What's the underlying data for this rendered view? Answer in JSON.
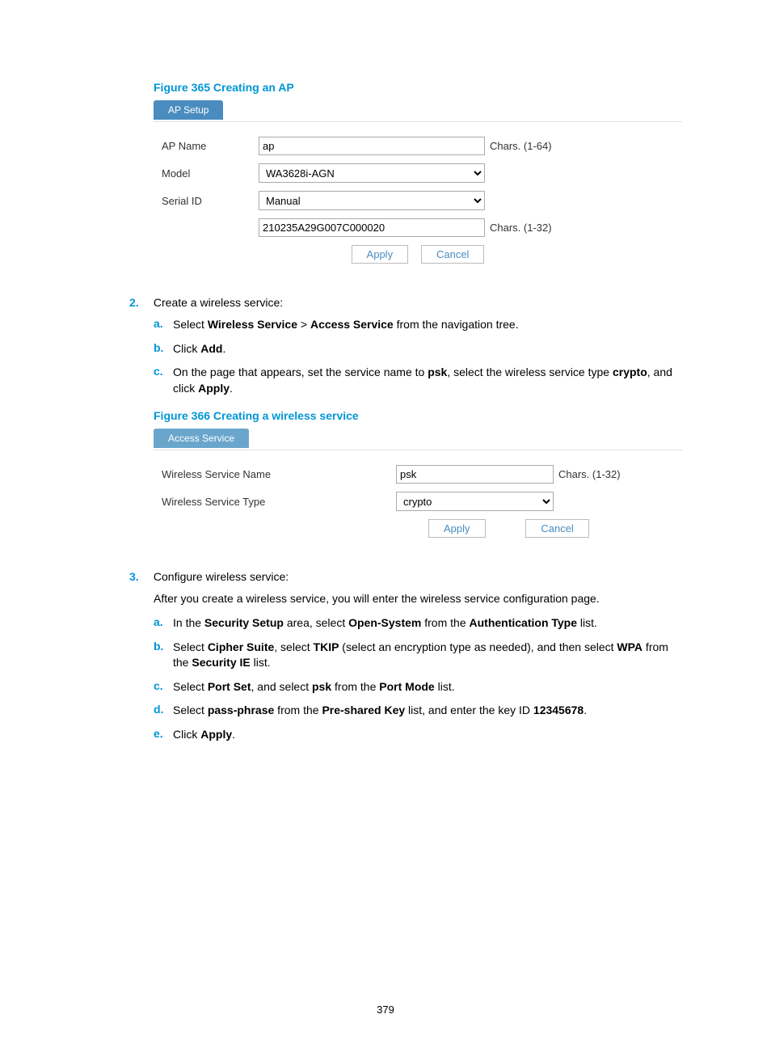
{
  "fig365": {
    "caption": "Figure 365 Creating an AP",
    "tab": "AP Setup",
    "rows": {
      "apname_label": "AP Name",
      "apname_value": "ap",
      "apname_hint": "Chars. (1-64)",
      "model_label": "Model",
      "model_value": "WA3628i-AGN",
      "serial_label": "Serial ID",
      "serial_value": "Manual",
      "serial_input": "210235A29G007C000020",
      "serial_hint": "Chars. (1-32)"
    },
    "apply": "Apply",
    "cancel": "Cancel"
  },
  "step2": {
    "num": "2.",
    "intro": "Create a wireless service:",
    "a": {
      "letter": "a.",
      "pre": "Select ",
      "b1": "Wireless Service",
      "mid": " > ",
      "b2": "Access Service",
      "post": " from the navigation tree."
    },
    "b": {
      "letter": "b.",
      "pre": "Click ",
      "b1": "Add",
      "post": "."
    },
    "c": {
      "letter": "c.",
      "pre": "On the page that appears, set the service name to ",
      "b1": "psk",
      "mid": ", select the wireless service type ",
      "b2": "crypto",
      "post1": ", and click ",
      "b3": "Apply",
      "post2": "."
    }
  },
  "fig366": {
    "caption": "Figure 366 Creating a wireless service",
    "tab": "Access Service",
    "rows": {
      "name_label": "Wireless Service Name",
      "name_value": "psk",
      "name_hint": "Chars. (1-32)",
      "type_label": "Wireless Service Type",
      "type_value": "crypto"
    },
    "apply": "Apply",
    "cancel": "Cancel"
  },
  "step3": {
    "num": "3.",
    "intro": "Configure wireless service:",
    "afterline": "After you create a wireless service, you will enter the wireless service configuration page.",
    "a": {
      "letter": "a.",
      "pre": "In the ",
      "b1": "Security Setup",
      "mid1": " area, select ",
      "b2": "Open-System",
      "mid2": " from the ",
      "b3": "Authentication Type",
      "post": " list."
    },
    "b": {
      "letter": "b.",
      "pre": "Select ",
      "b1": "Cipher Suite",
      "mid1": ", select ",
      "b2": "TKIP",
      "mid2": " (select an encryption type as needed), and then select ",
      "b3": "WPA",
      "mid3": " from the ",
      "b4": "Security IE",
      "post": " list."
    },
    "c": {
      "letter": "c.",
      "pre": "Select ",
      "b1": "Port Set",
      "mid1": ", and select ",
      "b2": "psk",
      "mid2": " from the ",
      "b3": "Port Mode",
      "post": " list."
    },
    "d": {
      "letter": "d.",
      "pre": "Select ",
      "b1": "pass-phrase",
      "mid1": " from the ",
      "b2": "Pre-shared Key",
      "mid2": " list, and enter the key ID ",
      "b3": "12345678",
      "post": "."
    },
    "e": {
      "letter": "e.",
      "pre": "Click ",
      "b1": "Apply",
      "post": "."
    }
  },
  "pagenum": "379"
}
